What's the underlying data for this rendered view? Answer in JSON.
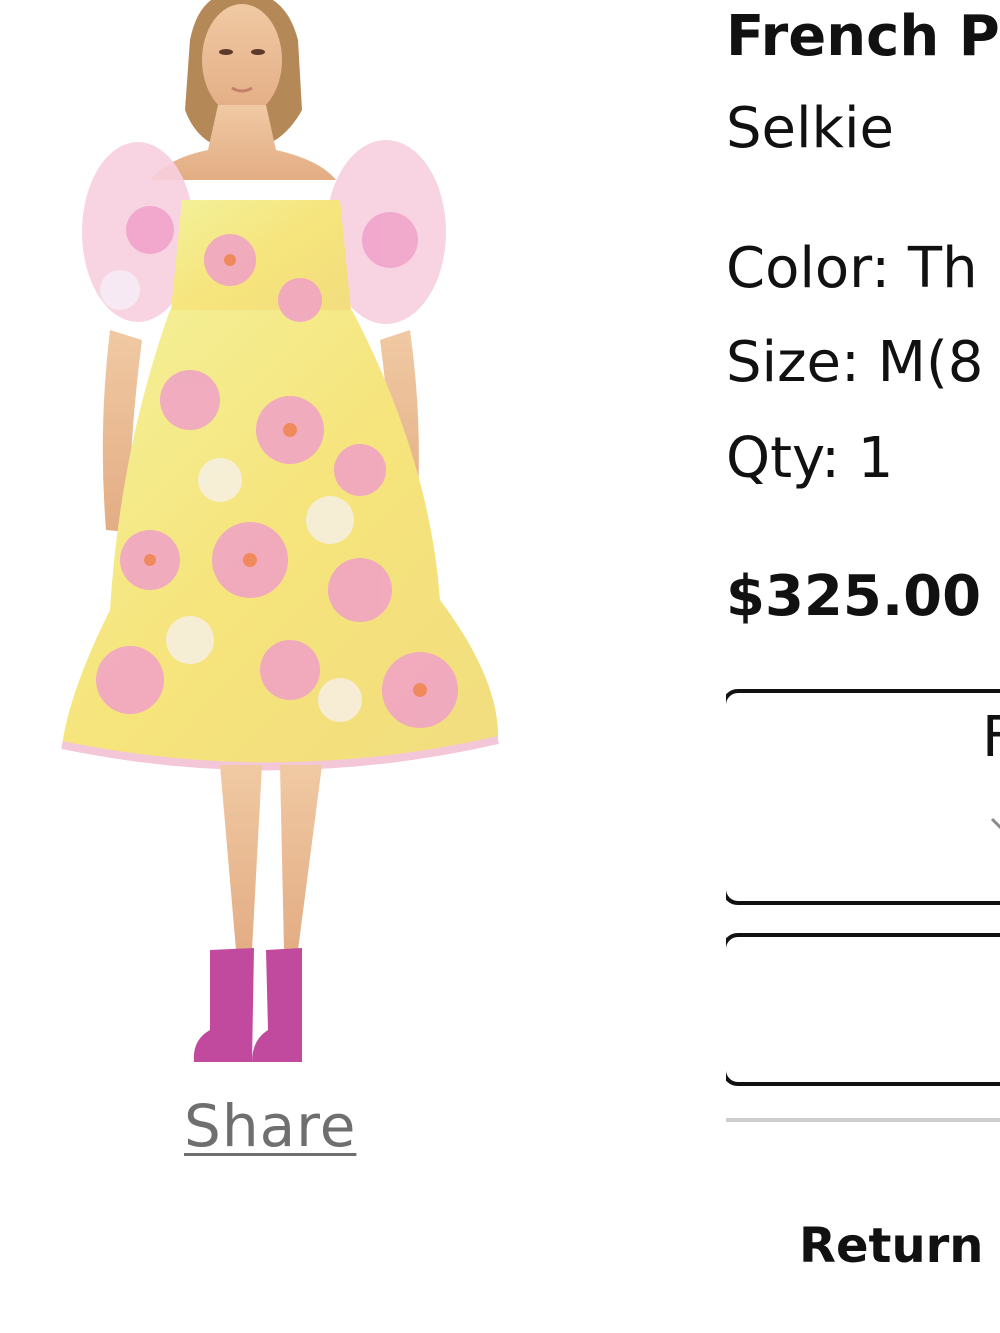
{
  "product": {
    "name": "French P",
    "brand": "Selkie",
    "color_text": "Color: Th",
    "size_text": "Size: M(8",
    "qty_text": "Qty: 1",
    "price": "$325.00"
  },
  "actions": {
    "box1_label": "F",
    "box1_icon": "chevron-down-icon"
  },
  "share": {
    "label": "Share"
  },
  "footer": {
    "return_text": "Return"
  },
  "colors": {
    "text": "#111111",
    "share_link": "#6f6f6f",
    "divider": "#cfcfcf"
  }
}
